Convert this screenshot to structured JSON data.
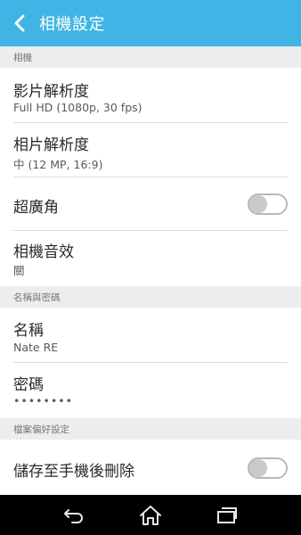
{
  "app_bar": {
    "title": "相機設定",
    "back_icon": "chevron-left-icon",
    "color": "#3fb4e5"
  },
  "sections": {
    "camera": {
      "header": "相機"
    },
    "name_password": {
      "header": "名稱與密碼"
    },
    "file_prefs": {
      "header": "檔案偏好設定"
    }
  },
  "settings": {
    "video_resolution": {
      "title": "影片解析度",
      "value": "Full HD (1080p, 30 fps)"
    },
    "photo_resolution": {
      "title": "相片解析度",
      "value": "中 (12 MP, 16:9)"
    },
    "super_wide": {
      "title": "超廣角",
      "enabled": false
    },
    "camera_sound": {
      "title": "相機音效",
      "value": "關"
    },
    "name": {
      "title": "名稱",
      "value": "Nate RE"
    },
    "password": {
      "title": "密碼",
      "value": "••••••••"
    },
    "delete_after_save": {
      "title": "儲存至手機後刪除",
      "enabled": false
    }
  },
  "nav_bar": {
    "back": "back-icon",
    "home": "home-icon",
    "recents": "recents-icon"
  }
}
